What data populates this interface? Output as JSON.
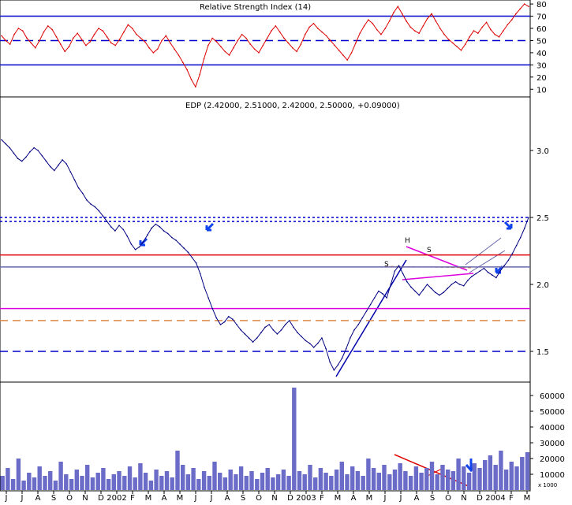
{
  "chart_data": [
    {
      "type": "line",
      "panel": "rsi",
      "title": "Relative Strength Index (14)",
      "yticks": [
        10,
        20,
        30,
        40,
        50,
        60,
        70,
        80
      ],
      "ylim": [
        5,
        82
      ],
      "reference_lines": [
        {
          "value": 70,
          "style": "solid",
          "color": "#0000cc"
        },
        {
          "value": 50,
          "style": "dashed",
          "color": "#0000cc"
        },
        {
          "value": 30,
          "style": "solid",
          "color": "#0000cc"
        }
      ],
      "series": [
        {
          "color": "#dd0000",
          "values": [
            54,
            50,
            47,
            55,
            60,
            58,
            52,
            48,
            44,
            50,
            57,
            62,
            59,
            53,
            47,
            41,
            45,
            52,
            56,
            51,
            46,
            49,
            55,
            60,
            58,
            53,
            48,
            46,
            51,
            57,
            63,
            60,
            55,
            52,
            49,
            44,
            40,
            43,
            50,
            54,
            48,
            43,
            38,
            32,
            26,
            18,
            12,
            22,
            35,
            46,
            52,
            49,
            45,
            41,
            38,
            44,
            50,
            55,
            52,
            47,
            43,
            40,
            46,
            52,
            58,
            62,
            57,
            52,
            48,
            44,
            41,
            47,
            55,
            61,
            64,
            60,
            57,
            54,
            50,
            46,
            42,
            38,
            34,
            40,
            48,
            56,
            62,
            67,
            64,
            59,
            55,
            60,
            66,
            73,
            78,
            72,
            66,
            61,
            58,
            56,
            62,
            68,
            72,
            66,
            60,
            55,
            51,
            48,
            45,
            42,
            47,
            53,
            58,
            56,
            61,
            65,
            59,
            55,
            53,
            58,
            63,
            67,
            72,
            76,
            80,
            78
          ]
        }
      ]
    },
    {
      "type": "line",
      "panel": "price",
      "title": "EDP (2.42000, 2.51000, 2.42000, 2.50000, +0.09000)",
      "yticks": [
        1.5,
        2.0,
        2.5,
        3.0
      ],
      "ylim": [
        1.3,
        3.3
      ],
      "reference_lines": [
        {
          "value": 2.5,
          "style": "dotted",
          "color": "#0000cc"
        },
        {
          "value": 2.47,
          "style": "dotted",
          "color": "#0000cc"
        },
        {
          "value": 2.22,
          "style": "solid",
          "color": "#dd0000"
        },
        {
          "value": 2.13,
          "style": "solid",
          "color": "#6666aa"
        },
        {
          "value": 1.82,
          "style": "solid",
          "color": "#dd00dd"
        },
        {
          "value": 1.73,
          "style": "dashed",
          "color": "#dd8844"
        },
        {
          "value": 1.5,
          "style": "dashed",
          "color": "#0000cc"
        }
      ],
      "annotations": [
        "S",
        "H",
        "S"
      ],
      "series": [
        {
          "color": "#000080",
          "values": [
            3.08,
            3.05,
            3.02,
            2.98,
            2.94,
            2.92,
            2.95,
            2.99,
            3.02,
            3.0,
            2.96,
            2.92,
            2.88,
            2.85,
            2.89,
            2.93,
            2.9,
            2.84,
            2.78,
            2.72,
            2.68,
            2.63,
            2.6,
            2.58,
            2.55,
            2.51,
            2.47,
            2.43,
            2.4,
            2.44,
            2.41,
            2.36,
            2.3,
            2.26,
            2.28,
            2.32,
            2.37,
            2.42,
            2.45,
            2.43,
            2.4,
            2.38,
            2.35,
            2.33,
            2.3,
            2.27,
            2.24,
            2.2,
            2.16,
            2.08,
            1.98,
            1.9,
            1.82,
            1.75,
            1.7,
            1.72,
            1.76,
            1.74,
            1.7,
            1.66,
            1.63,
            1.6,
            1.57,
            1.6,
            1.64,
            1.68,
            1.7,
            1.66,
            1.63,
            1.66,
            1.7,
            1.73,
            1.68,
            1.64,
            1.61,
            1.58,
            1.56,
            1.53,
            1.56,
            1.6,
            1.52,
            1.42,
            1.36,
            1.4,
            1.45,
            1.52,
            1.6,
            1.66,
            1.7,
            1.75,
            1.8,
            1.85,
            1.9,
            1.95,
            1.93,
            1.9,
            2.0,
            2.1,
            2.14,
            2.08,
            2.02,
            1.98,
            1.95,
            1.92,
            1.96,
            2.0,
            1.97,
            1.94,
            1.92,
            1.94,
            1.97,
            2.0,
            2.02,
            2.0,
            1.99,
            2.03,
            2.06,
            2.08,
            2.1,
            2.12,
            2.09,
            2.07,
            2.05,
            2.1,
            2.14,
            2.18,
            2.23,
            2.29,
            2.35,
            2.42,
            2.5
          ]
        }
      ]
    },
    {
      "type": "bar",
      "panel": "volume",
      "title": "",
      "yticks": [
        10000,
        20000,
        30000,
        40000,
        50000,
        60000
      ],
      "ytick_labels": [
        "10000",
        "20000",
        "30000",
        "40000",
        "50000",
        "60000"
      ],
      "unit_label": "x 1000",
      "ylim": [
        0,
        66000
      ],
      "color": "#6b6bc8",
      "values": [
        9000,
        14000,
        7000,
        20000,
        6000,
        11000,
        8000,
        15000,
        9000,
        12000,
        6000,
        18000,
        10000,
        7000,
        13000,
        9000,
        16000,
        8000,
        11000,
        14000,
        7000,
        10000,
        12000,
        9000,
        15000,
        8000,
        17000,
        11000,
        6000,
        13000,
        9000,
        12000,
        8000,
        25000,
        16000,
        10000,
        14000,
        7000,
        12000,
        9000,
        18000,
        11000,
        8000,
        13000,
        10000,
        15000,
        9000,
        12000,
        7000,
        11000,
        14000,
        8000,
        10000,
        13000,
        9000,
        65000,
        12000,
        10000,
        16000,
        8000,
        14000,
        11000,
        9000,
        13000,
        18000,
        10000,
        15000,
        12000,
        9000,
        20000,
        14000,
        11000,
        16000,
        10000,
        13000,
        17000,
        12000,
        9000,
        15000,
        11000,
        14000,
        18000,
        10000,
        16000,
        13000,
        12000,
        20000,
        15000,
        11000,
        17000,
        14000,
        19000,
        22000,
        16000,
        25000,
        13000,
        18000,
        15000,
        21000,
        24000
      ]
    }
  ],
  "xaxis": {
    "tick_labels": [
      "J",
      "J",
      "A",
      "S",
      "O",
      "N",
      "D",
      "2002",
      "F",
      "M",
      "A",
      "M",
      "J",
      "J",
      "A",
      "S",
      "O",
      "N",
      "D",
      "2003",
      "F",
      "M",
      "A",
      "M",
      "J",
      "J",
      "A",
      "S",
      "O",
      "N",
      "D",
      "2004",
      "F",
      "M"
    ]
  },
  "colors": {
    "background": "#ffffff",
    "grid": "#000000",
    "rsi_line": "#dd0000",
    "price_line": "#000080",
    "trendline_blue": "#0000aa",
    "trendline_magenta": "#dd00dd",
    "resistance_red": "#dd0000",
    "volume_bar": "#6b6bc8",
    "arrow": "#1144ee"
  }
}
